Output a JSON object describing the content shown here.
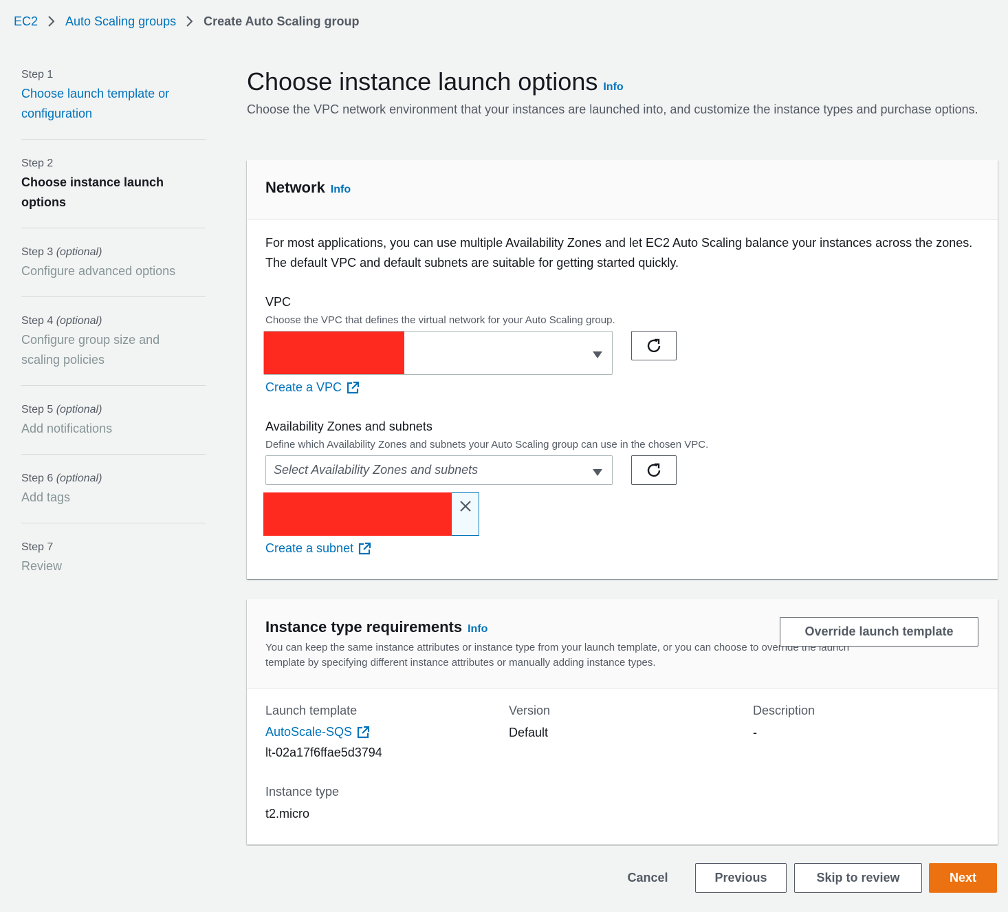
{
  "breadcrumb": {
    "items": [
      "EC2",
      "Auto Scaling groups",
      "Create Auto Scaling group"
    ]
  },
  "sidebar": {
    "steps": [
      {
        "num": "Step 1",
        "optional": "",
        "title": "Choose launch template or configuration",
        "state": "done"
      },
      {
        "num": "Step 2",
        "optional": "",
        "title": "Choose instance launch options",
        "state": "active"
      },
      {
        "num": "Step 3",
        "optional": "(optional)",
        "title": "Configure advanced options",
        "state": "disabled"
      },
      {
        "num": "Step 4",
        "optional": "(optional)",
        "title": "Configure group size and scaling policies",
        "state": "disabled"
      },
      {
        "num": "Step 5",
        "optional": "(optional)",
        "title": "Add notifications",
        "state": "disabled"
      },
      {
        "num": "Step 6",
        "optional": "(optional)",
        "title": "Add tags",
        "state": "disabled"
      },
      {
        "num": "Step 7",
        "optional": "",
        "title": "Review",
        "state": "disabled"
      }
    ]
  },
  "page": {
    "title": "Choose instance launch options",
    "info": "Info",
    "description": "Choose the VPC network environment that your instances are launched into, and customize the instance types and purchase options."
  },
  "network": {
    "title": "Network",
    "info": "Info",
    "intro": "For most applications, you can use multiple Availability Zones and let EC2 Auto Scaling balance your instances across the zones. The default VPC and default subnets are suitable for getting started quickly.",
    "vpc_label": "VPC",
    "vpc_desc": "Choose the VPC that defines the virtual network for your Auto Scaling group.",
    "create_vpc": "Create a VPC",
    "az_label": "Availability Zones and subnets",
    "az_desc": "Define which Availability Zones and subnets your Auto Scaling group can use in the chosen VPC.",
    "az_placeholder": "Select Availability Zones and subnets",
    "create_subnet": "Create a subnet"
  },
  "instance_type": {
    "title": "Instance type requirements",
    "info": "Info",
    "description": "You can keep the same instance attributes or instance type from your launch template, or you can choose to override the launch template by specifying different instance attributes or manually adding instance types.",
    "override_button": "Override launch template",
    "launch_template_label": "Launch template",
    "launch_template_name": "AutoScale-SQS",
    "launch_template_id": "lt-02a17f6ffae5d3794",
    "version_label": "Version",
    "version_value": "Default",
    "description_label": "Description",
    "description_value": "-",
    "instance_type_label": "Instance type",
    "instance_type_value": "t2.micro"
  },
  "footer": {
    "cancel": "Cancel",
    "previous": "Previous",
    "skip": "Skip to review",
    "next": "Next"
  },
  "colors": {
    "link": "#0073bb",
    "primary": "#ec7211",
    "redaction": "#ff2a1f"
  }
}
